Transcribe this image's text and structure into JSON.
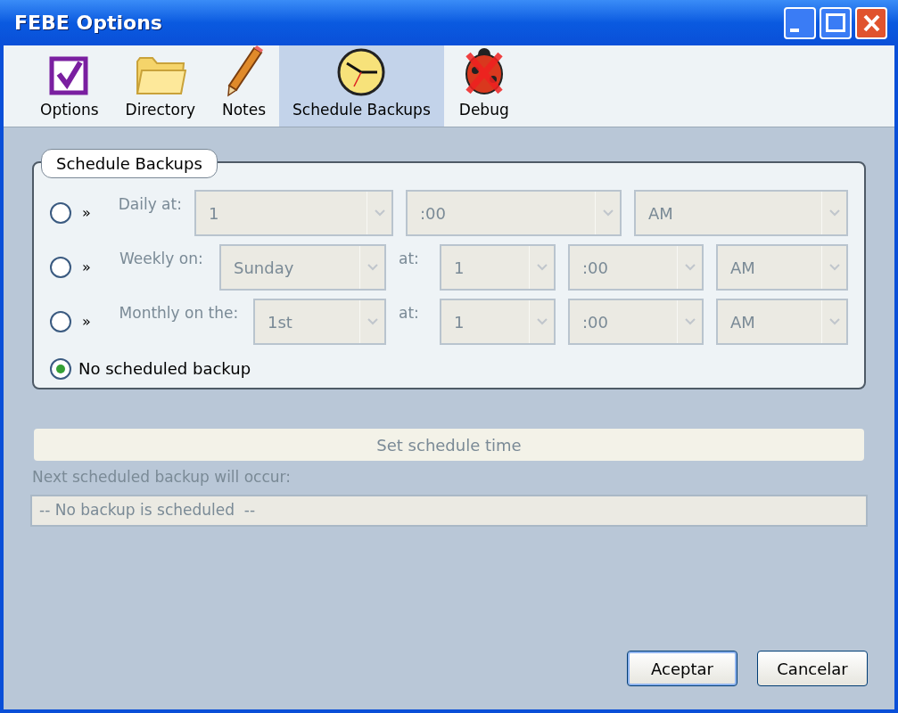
{
  "window": {
    "title": "FEBE Options"
  },
  "tabs": [
    {
      "label": "Options",
      "selected": false
    },
    {
      "label": "Directory",
      "selected": false
    },
    {
      "label": "Notes",
      "selected": false
    },
    {
      "label": "Schedule Backups",
      "selected": true
    },
    {
      "label": "Debug",
      "selected": false
    }
  ],
  "group": {
    "title": "Schedule Backups",
    "rows": [
      {
        "kind": "schedule",
        "selected": false,
        "marker": "»",
        "label": "Daily at:",
        "parts": [
          {
            "kind": "combo",
            "value": "1",
            "disabled": true
          },
          {
            "kind": "combo",
            "value": ":00",
            "disabled": true
          },
          {
            "kind": "combo",
            "value": "AM",
            "disabled": true
          }
        ]
      },
      {
        "kind": "schedule",
        "selected": false,
        "marker": "»",
        "label": "Weekly on:",
        "parts": [
          {
            "kind": "combo",
            "value": "Sunday",
            "disabled": true
          },
          {
            "kind": "text",
            "text": "at:"
          },
          {
            "kind": "combo",
            "value": "1",
            "disabled": true
          },
          {
            "kind": "combo",
            "value": ":00",
            "disabled": true
          },
          {
            "kind": "combo",
            "value": "AM",
            "disabled": true
          }
        ]
      },
      {
        "kind": "schedule",
        "selected": false,
        "marker": "»",
        "label": "Monthly on the:",
        "parts": [
          {
            "kind": "combo",
            "value": "1st",
            "disabled": true
          },
          {
            "kind": "text",
            "text": "at:"
          },
          {
            "kind": "combo",
            "value": "1",
            "disabled": true
          },
          {
            "kind": "combo",
            "value": ":00",
            "disabled": true
          },
          {
            "kind": "combo",
            "value": "AM",
            "disabled": true
          }
        ]
      },
      {
        "kind": "none",
        "selected": true,
        "label": "No scheduled backup"
      }
    ]
  },
  "set_button": {
    "label": "Set schedule time",
    "disabled": true
  },
  "next": {
    "label": "Next scheduled backup will occur:",
    "value": "-- No backup is scheduled  --"
  },
  "buttons": [
    {
      "label": "Aceptar",
      "default": true
    },
    {
      "label": "Cancelar",
      "default": false
    }
  ]
}
